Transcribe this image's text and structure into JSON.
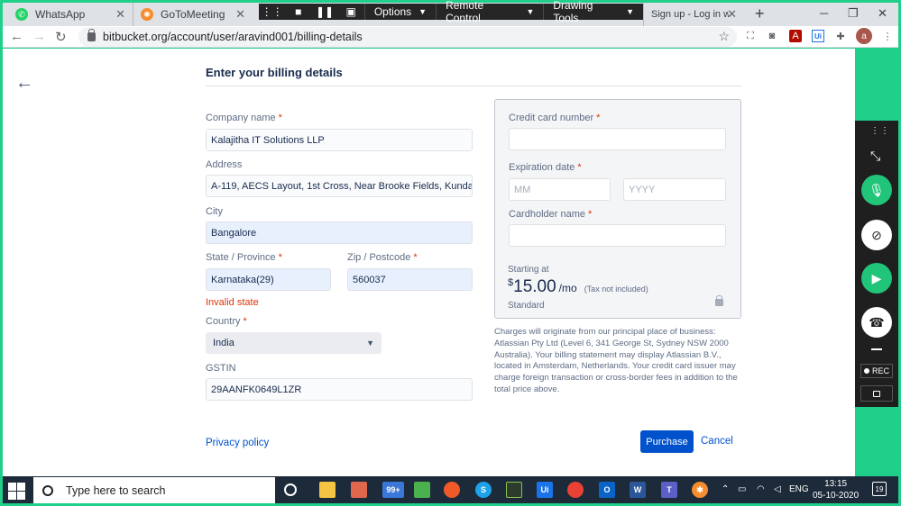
{
  "browser": {
    "tabs": [
      {
        "label": "WhatsApp",
        "color": "#25d366"
      },
      {
        "label": "GoToMeeting",
        "color": "#f68d2e"
      },
      {
        "label": "Sign up - Log in with",
        "color": "#0052cc"
      }
    ],
    "url": "bitbucket.org/account/user/aravind001/billing-details",
    "profile_initial": "a"
  },
  "remote_toolbar": {
    "menus": [
      "Options",
      "Remote Control",
      "Drawing Tools"
    ]
  },
  "page": {
    "heading": "Enter your billing details",
    "form": {
      "company_label": "Company name",
      "company_value": "Kalajitha IT Solutions LLP",
      "address_label": "Address",
      "address_value": "A-119, AECS Layout, 1st Cross, Near Brooke Fields, Kundalahalli",
      "city_label": "City",
      "city_value": "Bangalore",
      "state_label": "State / Province",
      "state_value": "Karnataka(29)",
      "state_error": "Invalid state",
      "zip_label": "Zip / Postcode",
      "zip_value": "560037",
      "country_label": "Country",
      "country_value": "India",
      "gstin_label": "GSTIN",
      "gstin_value": "29AANFK0649L1ZR"
    },
    "card": {
      "number_label": "Credit card number",
      "expiration_label": "Expiration date",
      "month_placeholder": "MM",
      "year_placeholder": "YYYY",
      "holder_label": "Cardholder name",
      "starting_at": "Starting at",
      "currency": "$",
      "amount": "15.00",
      "period": "/mo",
      "tax_note": "(Tax not included)",
      "plan": "Standard"
    },
    "charges_note": "Charges will originate from our principal place of business: Atlassian Pty Ltd (Level 6, 341 George St, Sydney NSW 2000 Australia). Your billing statement may display Atlassian B.V., located in Amsterdam, Netherlands. Your credit card issuer may charge foreign transaction or cross-border fees in addition to the total price above.",
    "privacy_link": "Privacy policy",
    "purchase_label": "Purchase",
    "cancel_label": "Cancel"
  },
  "side_panel": {
    "rec_label": "REC"
  },
  "taskbar": {
    "search_placeholder": "Type here to search",
    "badge_count": "99+",
    "language": "ENG",
    "time": "13:15",
    "date": "05-10-2020",
    "notification_count": "19"
  },
  "colors": {
    "accent": "#0052cc",
    "error": "#de350b",
    "frame": "#1fcf8a"
  }
}
